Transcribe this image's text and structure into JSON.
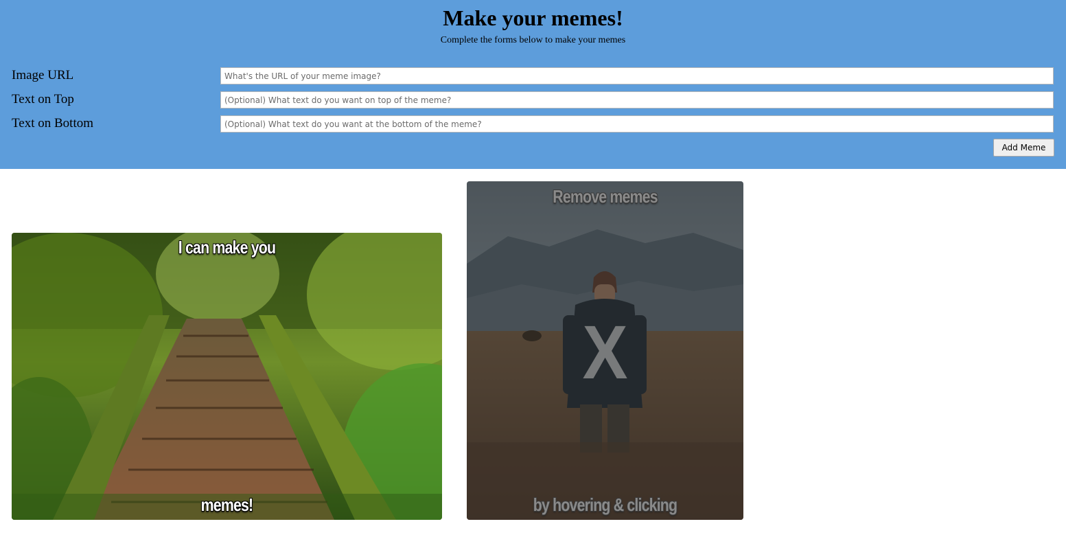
{
  "header": {
    "title": "Make your memes!",
    "subtitle": "Complete the forms below to make your memes",
    "background": "#5d9ddb"
  },
  "form": {
    "image_url": {
      "label": "Image URL",
      "placeholder": "What's the URL of your meme image?",
      "value": ""
    },
    "text_top": {
      "label": "Text on Top",
      "placeholder": "(Optional) What text do you want on top of the meme?",
      "value": ""
    },
    "text_bottom": {
      "label": "Text on Bottom",
      "placeholder": "(Optional) What text do you want at the bottom of the meme?",
      "value": ""
    },
    "submit_label": "Add Meme"
  },
  "memes": [
    {
      "top_text": "I can make you",
      "bottom_text": "memes!",
      "image": "mossy-forest-boardwalk-photo",
      "hovered": false
    },
    {
      "top_text": "Remove memes",
      "bottom_text": "by hovering & clicking",
      "image": "man-in-field-mountains-photo",
      "hovered": true,
      "remove_label": "X"
    }
  ]
}
